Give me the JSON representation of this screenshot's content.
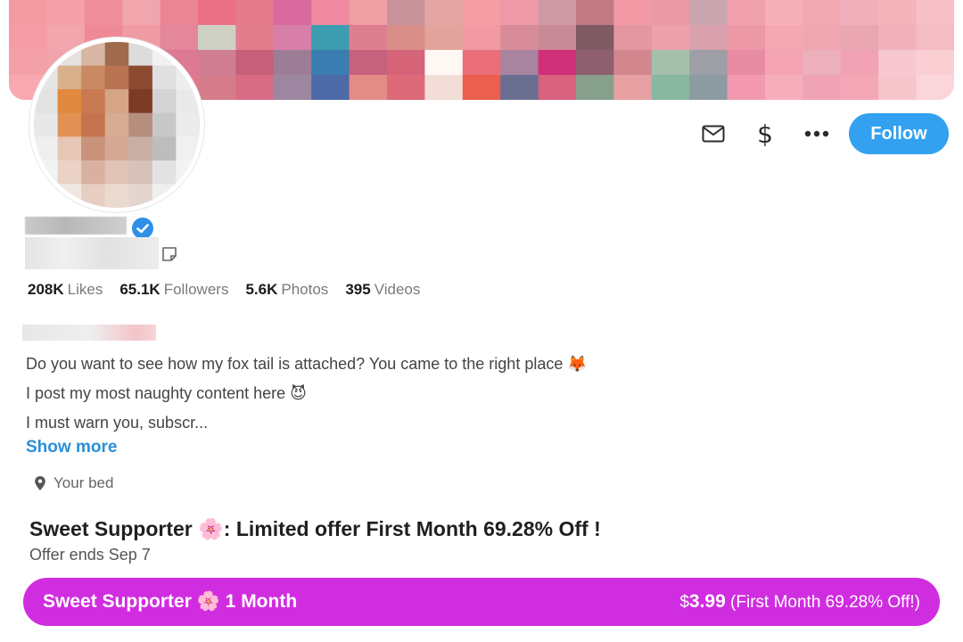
{
  "profile": {
    "follow_label": "Follow",
    "stats": [
      {
        "value": "208K",
        "label": "Likes"
      },
      {
        "value": "65.1K",
        "label": "Followers"
      },
      {
        "value": "5.6K",
        "label": "Photos"
      },
      {
        "value": "395",
        "label": "Videos"
      }
    ],
    "bio_lines": [
      "Do you want to see how my fox tail is attached? You came to the right place 🦊",
      "I post my most naughty content here 😈",
      "I must warn you, subscr..."
    ],
    "show_more_label": "Show more",
    "location": "Your bed"
  },
  "offer": {
    "title": "Sweet Supporter 🌸: Limited offer First Month 69.28% Off !",
    "subtitle": "Offer ends Sep 7",
    "bar_left": "Sweet Supporter 🌸 1 Month",
    "bar_currency": "$",
    "bar_price": "3.99",
    "bar_note": "(First Month 69.28% Off!)"
  },
  "icons": {
    "message": "mail-icon",
    "tip": "dollar-icon",
    "more": "more-dots-icon",
    "verified": "verified-badge-icon",
    "note": "note-icon",
    "location": "location-pin-icon"
  },
  "colors": {
    "accent": "#33a1ef",
    "subscribe_bar": "#d02de0",
    "link": "#2a8fd8"
  }
}
